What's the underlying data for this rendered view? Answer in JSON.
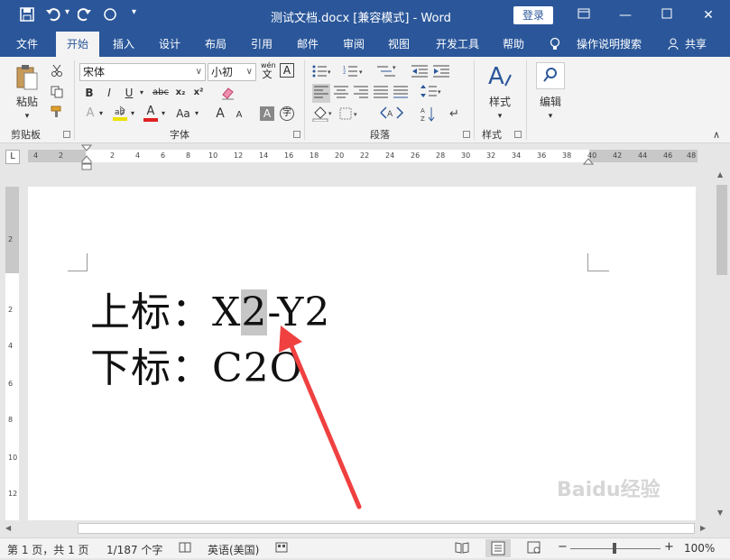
{
  "window": {
    "title": "测试文档.docx [兼容模式] - Word",
    "login_label": "登录",
    "quick_access": [
      "save-icon",
      "undo-icon",
      "redo-icon",
      "circle-icon",
      "customize-icon"
    ]
  },
  "tabs": [
    {
      "label": "文件"
    },
    {
      "label": "开始"
    },
    {
      "label": "插入"
    },
    {
      "label": "设计"
    },
    {
      "label": "布局"
    },
    {
      "label": "引用"
    },
    {
      "label": "邮件"
    },
    {
      "label": "审阅"
    },
    {
      "label": "视图"
    },
    {
      "label": "开发工具"
    },
    {
      "label": "帮助"
    },
    {
      "label": "操作说明搜索"
    },
    {
      "label": "共享"
    }
  ],
  "active_tab": "开始",
  "ribbon": {
    "clipboard": {
      "paste_label": "粘贴",
      "group_label": "剪贴板"
    },
    "font": {
      "font_name": "宋体",
      "font_size": "小初",
      "wen": "wén",
      "wen_char": "文",
      "bold": "B",
      "italic": "I",
      "underline": "U",
      "strike": "abc",
      "subscript": "x₂",
      "superscript": "x²",
      "font_color": "A",
      "aa": "Aa",
      "grow": "A",
      "shrink": "A",
      "group_label": "字体"
    },
    "paragraph": {
      "group_label": "段落"
    },
    "styles": {
      "button_label": "样式",
      "group_label": "样式"
    },
    "editing": {
      "button_label": "编辑"
    }
  },
  "ruler": {
    "h_ticks": [
      "4",
      "2",
      "2",
      "4",
      "6",
      "8",
      "10",
      "12",
      "14",
      "16",
      "18",
      "20",
      "22",
      "24",
      "26",
      "28",
      "30",
      "32",
      "34",
      "36",
      "38",
      "40",
      "42",
      "44",
      "46",
      "48"
    ],
    "v_ticks": [
      "2",
      "2",
      "4",
      "6",
      "8",
      "10",
      "12"
    ],
    "corner": "L"
  },
  "document": {
    "line1_prefix": "上标：X",
    "line1_highlight": "2",
    "line1_suffix": "-Y2",
    "line2": "下标：C2O"
  },
  "status": {
    "page": "第 1 页，共 1 页",
    "words": "1/187 个字",
    "language": "英语(美国)",
    "zoom": "100%"
  },
  "colors": {
    "accent": "#2b579a",
    "highlight": "#f0e000",
    "font_color_red": "#e02020",
    "annotation_arrow": "#f04040"
  }
}
